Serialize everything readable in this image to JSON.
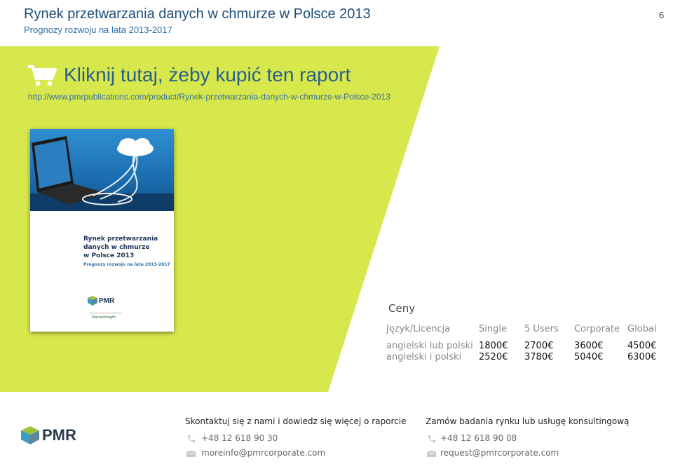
{
  "header": {
    "title": "Rynek przetwarzania danych w chmurze w Polsce 2013",
    "subtitle": "Prognozy rozwoju na lata 2013-2017",
    "page_number": "6"
  },
  "buy": {
    "cta_label": "Kliknij tutaj, żeby kupić ten raport",
    "url": "http://www.pmrpublications.com/product/Rynek-przetwarzania-danych-w-chmurze-w-Polsce-2013"
  },
  "cover": {
    "title_line1": "Rynek przetwarzania",
    "title_line2": "danych w chmurze",
    "title_line3": "w Polsce 2013",
    "subtitle": "Prognozy rozwoju na lata 2013-2017",
    "logo": "PMR",
    "partner": "MarketInsight"
  },
  "prices": {
    "heading": "Ceny",
    "columns": [
      "Język/Licencja",
      "Single",
      "5 Users",
      "Corporate",
      "Global"
    ],
    "rows": [
      {
        "label": "angielski lub polski",
        "values": [
          "1800€",
          "2700€",
          "3600€",
          "4500€"
        ]
      },
      {
        "label": "angielski i polski",
        "values": [
          "2520€",
          "3780€",
          "5040€",
          "6300€"
        ]
      }
    ]
  },
  "footer": {
    "logo_text": "PMR",
    "contact1": {
      "heading": "Skontaktuj się z nami i dowiedz się więcej o raporcie",
      "phone": "+48 12 618 90 30",
      "email": "moreinfo@pmrcorporate.com"
    },
    "contact2": {
      "heading": "Zamów badania rynku lub  usługę konsultingową",
      "phone": "+48 12 618 90 08",
      "email": "request@pmrcorporate.com"
    }
  },
  "colors": {
    "accent_green": "#d7e84c",
    "brand_blue": "#1f4e79"
  }
}
